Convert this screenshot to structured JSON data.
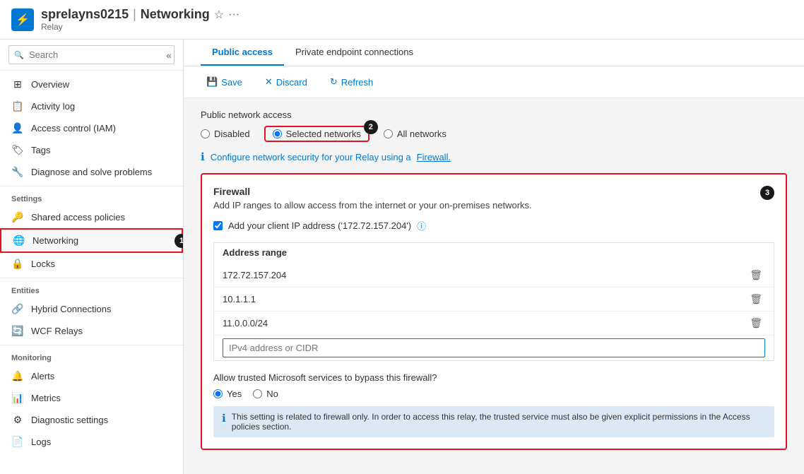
{
  "header": {
    "icon": "⚡",
    "resource_name": "sprelayns0215",
    "separator": "|",
    "page_title": "Networking",
    "resource_type": "Relay",
    "favorite_icon": "☆",
    "more_icon": "···"
  },
  "sidebar": {
    "search_placeholder": "Search",
    "collapse_icon": "«",
    "nav_items": [
      {
        "id": "overview",
        "label": "Overview",
        "icon": "⊞",
        "active": false
      },
      {
        "id": "activity-log",
        "label": "Activity log",
        "icon": "📋",
        "active": false
      },
      {
        "id": "access-control",
        "label": "Access control (IAM)",
        "icon": "👤",
        "active": false
      },
      {
        "id": "tags",
        "label": "Tags",
        "icon": "🏷",
        "active": false
      },
      {
        "id": "diagnose",
        "label": "Diagnose and solve problems",
        "icon": "🔧",
        "active": false
      }
    ],
    "sections": [
      {
        "label": "Settings",
        "items": [
          {
            "id": "shared-access",
            "label": "Shared access policies",
            "icon": "🔑",
            "active": false
          },
          {
            "id": "networking",
            "label": "Networking",
            "icon": "🌐",
            "active": true
          },
          {
            "id": "locks",
            "label": "Locks",
            "icon": "🔒",
            "active": false
          }
        ]
      },
      {
        "label": "Entities",
        "items": [
          {
            "id": "hybrid-connections",
            "label": "Hybrid Connections",
            "icon": "🔗",
            "active": false
          },
          {
            "id": "wcf-relays",
            "label": "WCF Relays",
            "icon": "🔄",
            "active": false
          }
        ]
      },
      {
        "label": "Monitoring",
        "items": [
          {
            "id": "alerts",
            "label": "Alerts",
            "icon": "🔔",
            "active": false
          },
          {
            "id": "metrics",
            "label": "Metrics",
            "icon": "📊",
            "active": false
          },
          {
            "id": "diagnostic-settings",
            "label": "Diagnostic settings",
            "icon": "⚙",
            "active": false
          },
          {
            "id": "logs",
            "label": "Logs",
            "icon": "📄",
            "active": false
          }
        ]
      }
    ]
  },
  "tabs": [
    {
      "id": "public-access",
      "label": "Public access",
      "active": true
    },
    {
      "id": "private-endpoint",
      "label": "Private endpoint connections",
      "active": false
    }
  ],
  "toolbar": {
    "save_label": "Save",
    "discard_label": "Discard",
    "refresh_label": "Refresh"
  },
  "public_network_access": {
    "label": "Public network access",
    "options": [
      {
        "id": "disabled",
        "label": "Disabled",
        "selected": false
      },
      {
        "id": "selected-networks",
        "label": "Selected networks",
        "selected": true
      },
      {
        "id": "all-networks",
        "label": "All networks",
        "selected": false
      }
    ],
    "step_badge": "2"
  },
  "info_text": "Configure network security for your Relay using a Firewall.",
  "firewall": {
    "step_badge": "3",
    "title": "Firewall",
    "description": "Add IP ranges to allow access from the internet or your on-premises networks.",
    "client_ip_checkbox_label": "Add your client IP address ('172.72.157.204')",
    "client_ip_checked": true,
    "address_range_header": "Address range",
    "addresses": [
      {
        "value": "172.72.157.204"
      },
      {
        "value": "10.1.1.1"
      },
      {
        "value": "11.0.0.0/24"
      }
    ],
    "ip_input_placeholder": "IPv4 address or CIDR"
  },
  "trusted_services": {
    "label": "Allow trusted Microsoft services to bypass this firewall?",
    "options": [
      {
        "id": "yes",
        "label": "Yes",
        "selected": true
      },
      {
        "id": "no",
        "label": "No",
        "selected": false
      }
    ]
  },
  "info_bottom": "This setting is related to firewall only. In order to access this relay, the trusted service must also be given explicit permissions in the Access policies section.",
  "step_badges": {
    "networking_sidebar": "1",
    "selected_networks": "2",
    "firewall": "3"
  }
}
